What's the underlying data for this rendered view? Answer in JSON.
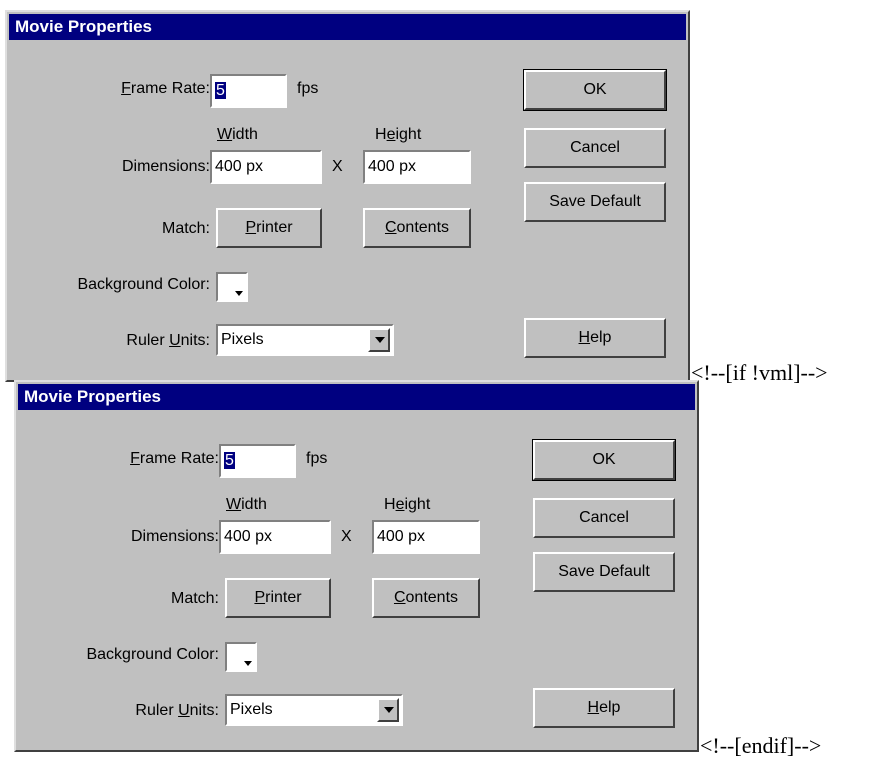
{
  "dialog": {
    "title": "Movie Properties",
    "frame_rate": {
      "label_key": "F",
      "label_rest": "rame Rate:",
      "value": "5",
      "unit": "fps"
    },
    "dimensions": {
      "label": "Dimensions:",
      "width_key": "W",
      "width_rest": "idth",
      "height_pre": "H",
      "height_key": "e",
      "height_rest": "ight",
      "width_value": "400 px",
      "separator": "X",
      "height_value": "400 px"
    },
    "match": {
      "label": "Match:",
      "printer_key": "P",
      "printer_rest": "rinter",
      "contents_key": "C",
      "contents_rest": "ontents"
    },
    "background_color": {
      "label": "Background Color:",
      "color": "#ffffff"
    },
    "ruler_units": {
      "label_pre": "Ruler ",
      "label_key": "U",
      "label_rest": "nits:",
      "value": "Pixels"
    },
    "buttons": {
      "ok": "OK",
      "cancel": "Cancel",
      "save_default": "Save Default",
      "help_key": "H",
      "help_rest": "elp"
    }
  },
  "comments": {
    "if_vml": "<!--[if !vml]-->",
    "endif": "<!--[endif]-->"
  },
  "colors": {
    "dialog_bg": "#c0c0c0",
    "titlebar": "#000080",
    "selection": "#000080"
  }
}
